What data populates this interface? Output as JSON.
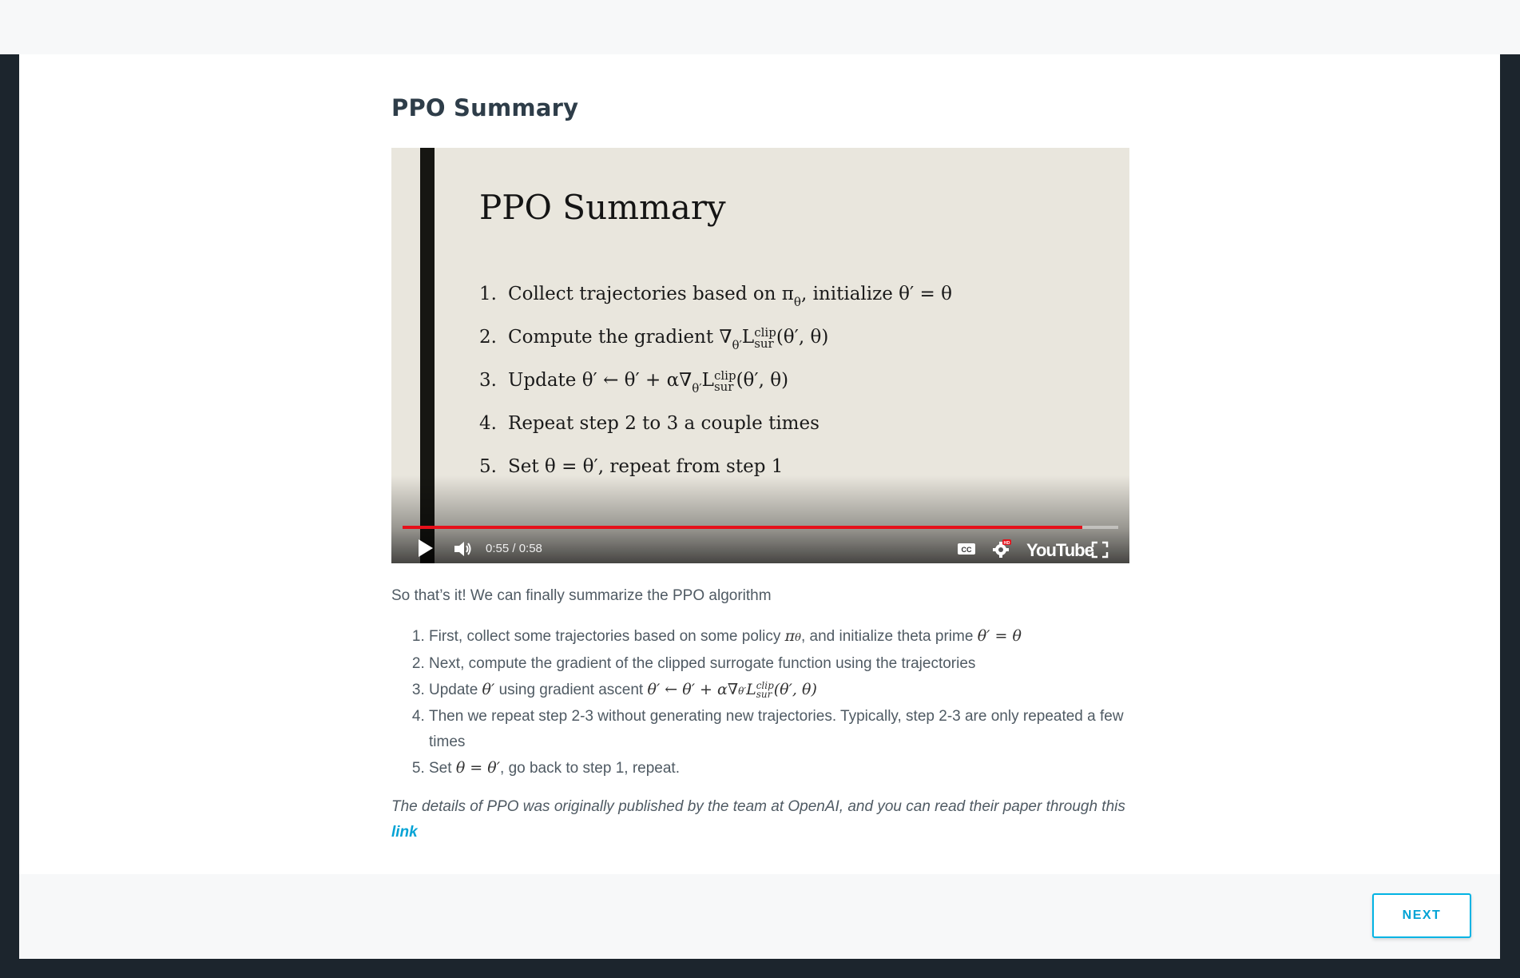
{
  "page": {
    "title": "PPO Summary"
  },
  "video": {
    "slide_title": "PPO Summary",
    "slide_items": [
      {
        "num": "1.",
        "text": "Collect trajectories based on π",
        "sub": "θ",
        "rest": ", initialize θ′ = θ"
      },
      {
        "num": "2.",
        "text": "Compute the gradient ∇",
        "sub": "θ′",
        "rest": "L",
        "sup2": "clip",
        "sub2": "sur",
        "tail": "(θ′, θ)"
      },
      {
        "num": "3.",
        "text": "Update  θ′ ← θ′ + α∇",
        "sub": "θ′",
        "rest": "L",
        "sup2": "clip",
        "sub2": "sur",
        "tail": "(θ′, θ)"
      },
      {
        "num": "4.",
        "text": "Repeat step 2 to 3 a couple times"
      },
      {
        "num": "5.",
        "text": "Set θ = θ′, repeat from step 1"
      }
    ],
    "time_display": "0:55 / 0:58",
    "progress": 0.95,
    "yt_logo": "YouTube",
    "hd_badge": "HD",
    "accent_red": "#e6101a"
  },
  "body": {
    "intro": "So that’s it! We can finally summarize the PPO algorithm",
    "steps": [
      {
        "pre": "First, collect some trajectories based on some policy ",
        "m1": "π",
        "m1sub": "θ",
        "mid": ", and initialize theta prime ",
        "m2": "θ′ = θ"
      },
      {
        "pre": "Next, compute the gradient of the clipped surrogate function using the trajectories"
      },
      {
        "pre": "Update ",
        "m1": "θ′",
        "mid": " using gradient ascent ",
        "m2": "θ′ ← θ′ + α∇",
        "m2sub": "θ′",
        "m3": "L",
        "m3sup": "clip",
        "m3sub": "sur",
        "m4": "(θ′, θ)"
      },
      {
        "pre": "Then we repeat step 2-3 without generating new trajectories. Typically, step 2-3 are only repeated a few times"
      },
      {
        "pre": "Set ",
        "m1": "θ = θ′",
        "mid": ", go back to step 1, repeat."
      }
    ],
    "note": "The details of PPO was originally published by the team at OpenAI, and you can read their paper through this ",
    "link_text": "link"
  },
  "footer": {
    "next_label": "NEXT"
  },
  "colors": {
    "next_border": "#02b3e4",
    "link": "#02a3d5",
    "dark_frame": "#1c252d"
  }
}
